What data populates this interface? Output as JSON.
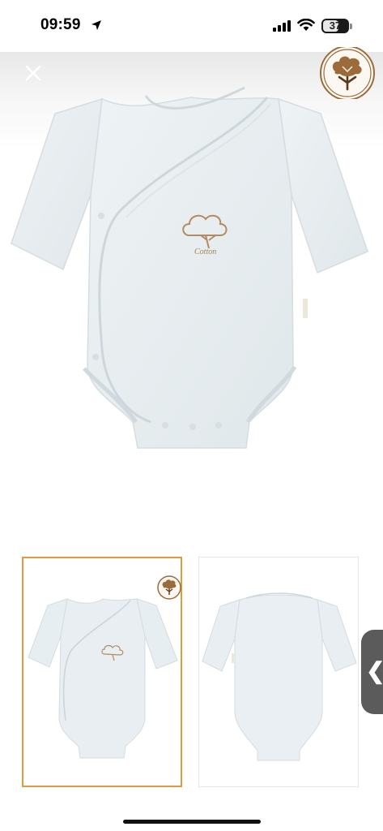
{
  "status_bar": {
    "time": "09:59",
    "battery": "37",
    "icons": [
      "location-arrow-icon",
      "cellular-signal-icon",
      "wifi-icon",
      "battery-icon"
    ]
  },
  "viewer": {
    "close_icon": "close-icon",
    "brand_logo": "cotton-plant-logo",
    "garment_print": "Cotton",
    "images": [
      {
        "view": "front",
        "selected": true
      },
      {
        "view": "back",
        "selected": false
      }
    ],
    "accent_color": "#e29a3c",
    "logo_color": "#9b6b3a",
    "handle_icon": "chevron-left-icon",
    "handle_glyph": "❮"
  }
}
